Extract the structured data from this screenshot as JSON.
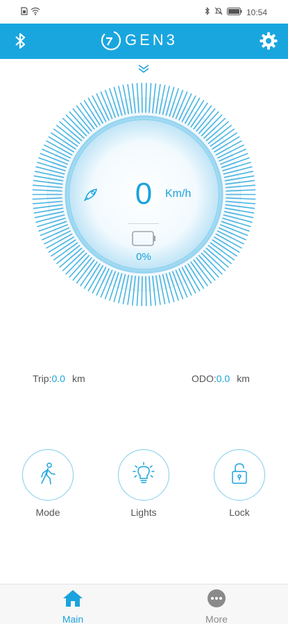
{
  "status_bar": {
    "time": "10:54",
    "icons": [
      "sim-icon",
      "wifi-icon",
      "bluetooth-icon",
      "mute-icon",
      "battery-icon"
    ]
  },
  "app_bar": {
    "title": "GEN3",
    "left_icon": "bluetooth-icon",
    "right_icon": "gear-icon",
    "color": "#19a6df"
  },
  "dashboard": {
    "speed": "0",
    "speed_unit": "Km/h",
    "battery_percent": "0%",
    "battery_level": 0,
    "accent": "#1aa3dc"
  },
  "stats": {
    "trip_label": "Trip:",
    "trip_value": "0.0",
    "trip_unit": "km",
    "odo_label": "ODO:",
    "odo_value": "0.0",
    "odo_unit": "km"
  },
  "controls": [
    {
      "label": "Mode",
      "icon": "walking-person-icon"
    },
    {
      "label": "Lights",
      "icon": "light-bulb-icon"
    },
    {
      "label": "Lock",
      "icon": "unlocked-padlock-icon"
    }
  ],
  "bottom_nav": {
    "items": [
      {
        "label": "Main",
        "icon": "home-icon",
        "active": true
      },
      {
        "label": "More",
        "icon": "more-icon",
        "active": false
      }
    ],
    "active_color": "#1aa3dc",
    "inactive_color": "#8a8a8a"
  }
}
